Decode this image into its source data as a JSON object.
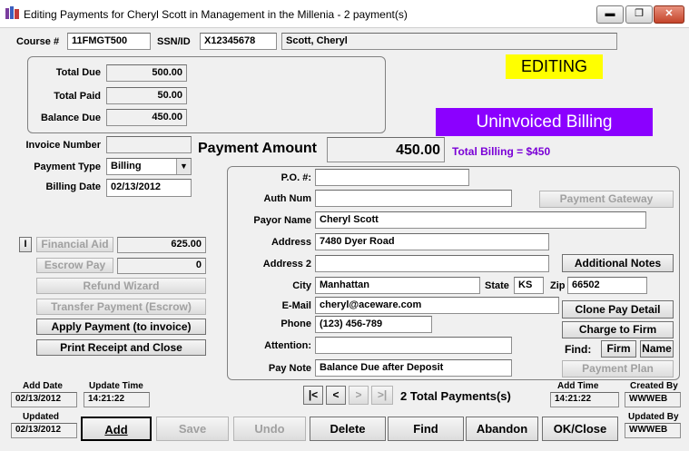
{
  "window": {
    "title": "Editing Payments for Cheryl Scott in Management in the Millenia - 2 payment(s)",
    "min": "▬",
    "max": "❐",
    "close": "✕"
  },
  "header": {
    "course_label": "Course #",
    "course_value": "11FMGT500",
    "ssn_label": "SSN/ID",
    "ssn_value": "X12345678",
    "name_value": "Scott, Cheryl"
  },
  "totals": {
    "due_label": "Total Due",
    "due_value": "500.00",
    "paid_label": "Total Paid",
    "paid_value": "50.00",
    "balance_label": "Balance Due",
    "balance_value": "450.00"
  },
  "status": {
    "editing": "EDITING",
    "uninvoiced": "Uninvoiced Billing"
  },
  "payment": {
    "invoice_label": "Invoice Number",
    "invoice_value": "",
    "type_label": "Payment Type",
    "type_value": "Billing",
    "date_label": "Billing Date",
    "date_value": "02/13/2012",
    "amount_label": "Payment Amount",
    "amount_value": "450.00",
    "total_billing": "Total Billing = $450"
  },
  "left": {
    "i_button": "I",
    "financial_aid_label": "Financial Aid",
    "financial_aid_value": "625.00",
    "escrow_label": "Escrow Pay",
    "escrow_value": "0",
    "refund_wizard": "Refund Wizard",
    "transfer_payment": "Transfer Payment (Escrow)",
    "apply_payment": "Apply Payment (to invoice)",
    "print_receipt": "Print Receipt and Close"
  },
  "payor": {
    "po_label": "P.O. #:",
    "po_value": "",
    "auth_label": "Auth Num",
    "auth_value": "",
    "name_label": "Payor Name",
    "name_value": "Cheryl Scott",
    "address_label": "Address",
    "address_value": "7480 Dyer Road",
    "address2_label": "Address 2",
    "address2_value": "",
    "city_label": "City",
    "city_value": "Manhattan",
    "state_label": "State",
    "state_value": "KS",
    "zip_label": "Zip",
    "zip_value": "66502",
    "email_label": "E-Mail",
    "email_value": "cheryl@aceware.com",
    "phone_label": "Phone",
    "phone_value": "(123) 456-789",
    "attention_label": "Attention:",
    "attention_value": "",
    "note_label": "Pay Note",
    "note_value": "Balance Due after Deposit"
  },
  "right_buttons": {
    "gateway": "Payment Gateway",
    "notes": "Additional Notes",
    "clone": "Clone Pay Detail",
    "charge": "Charge to Firm",
    "find_label": "Find:",
    "firm": "Firm",
    "name": "Name",
    "plan": "Payment Plan"
  },
  "footer": {
    "add_date_label": "Add Date",
    "add_date_value": "02/13/2012",
    "update_time_label": "Update Time",
    "update_time_value": "14:21:22",
    "updated_label": "Updated",
    "updated_value": "02/13/2012",
    "nav_first": "|<",
    "nav_prev": "<",
    "nav_next": ">",
    "nav_last": ">|",
    "total_payments": "2 Total Payments(s)",
    "add_time_label": "Add Time",
    "add_time_value": "14:21:22",
    "created_by_label": "Created By",
    "created_by_value": "WWWEB",
    "updated_by_label": "Updated By",
    "updated_by_value": "WWWEB"
  },
  "actions": {
    "add": "Add",
    "save": "Save",
    "undo": "Undo",
    "delete": "Delete",
    "find": "Find",
    "abandon": "Abandon",
    "ok_close": "OK/Close"
  }
}
